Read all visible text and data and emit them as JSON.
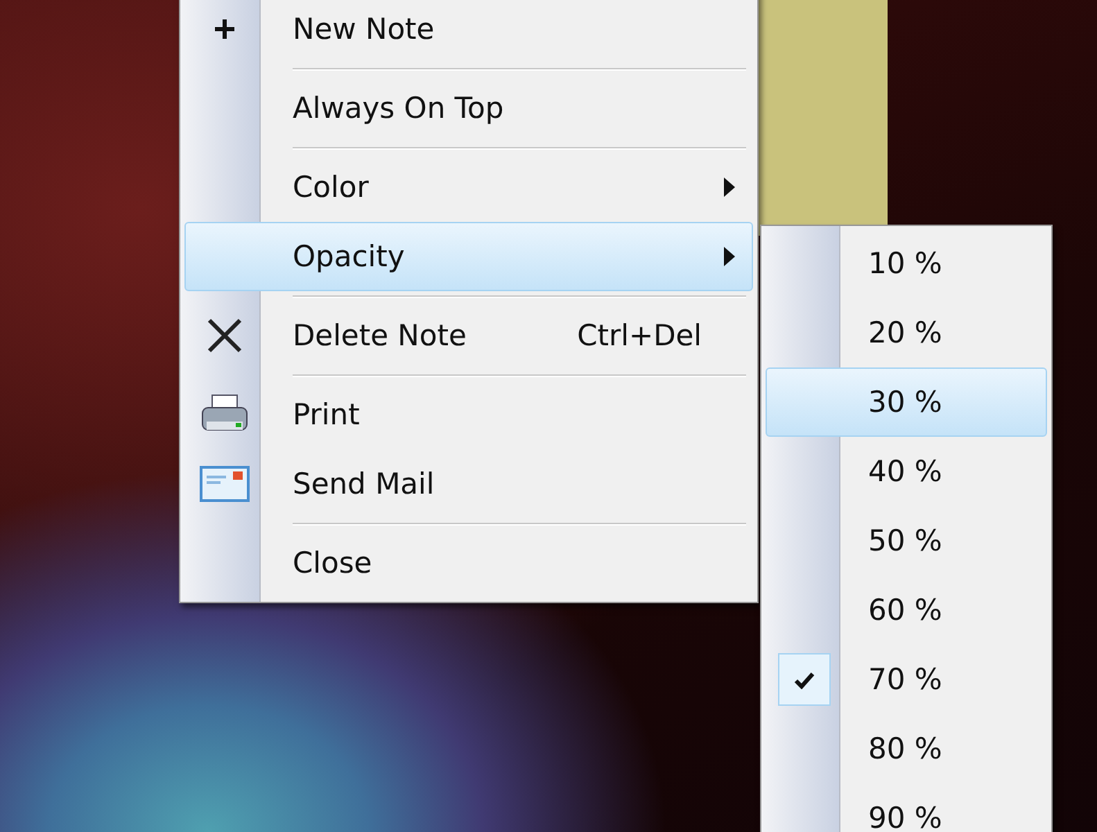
{
  "menu": {
    "items": [
      {
        "kind": "command",
        "label": "New Note",
        "highlighted": false
      },
      {
        "kind": "separator"
      },
      {
        "kind": "command",
        "label": "Always On Top",
        "highlighted": false
      },
      {
        "kind": "separator"
      },
      {
        "kind": "submenu",
        "label": "Color",
        "highlighted": false
      },
      {
        "kind": "submenu",
        "label": "Opacity",
        "highlighted": true
      },
      {
        "kind": "separator"
      },
      {
        "kind": "command",
        "label": "Delete Note",
        "shortcut": "Ctrl+Del",
        "highlighted": false
      },
      {
        "kind": "separator"
      },
      {
        "kind": "command",
        "label": "Print",
        "highlighted": false
      },
      {
        "kind": "command",
        "label": "Send Mail",
        "highlighted": false
      },
      {
        "kind": "separator"
      },
      {
        "kind": "command",
        "label": "Close",
        "highlighted": false
      }
    ]
  },
  "opacity_submenu": {
    "items": [
      {
        "label": "10 %",
        "highlighted": false,
        "checked": false
      },
      {
        "label": "20 %",
        "highlighted": false,
        "checked": false
      },
      {
        "label": "30 %",
        "highlighted": true,
        "checked": false
      },
      {
        "label": "40 %",
        "highlighted": false,
        "checked": false
      },
      {
        "label": "50 %",
        "highlighted": false,
        "checked": false
      },
      {
        "label": "60 %",
        "highlighted": false,
        "checked": false
      },
      {
        "label": "70 %",
        "highlighted": false,
        "checked": true
      },
      {
        "label": "80 %",
        "highlighted": false,
        "checked": false
      },
      {
        "label": "90 %",
        "highlighted": false,
        "checked": false
      }
    ]
  }
}
